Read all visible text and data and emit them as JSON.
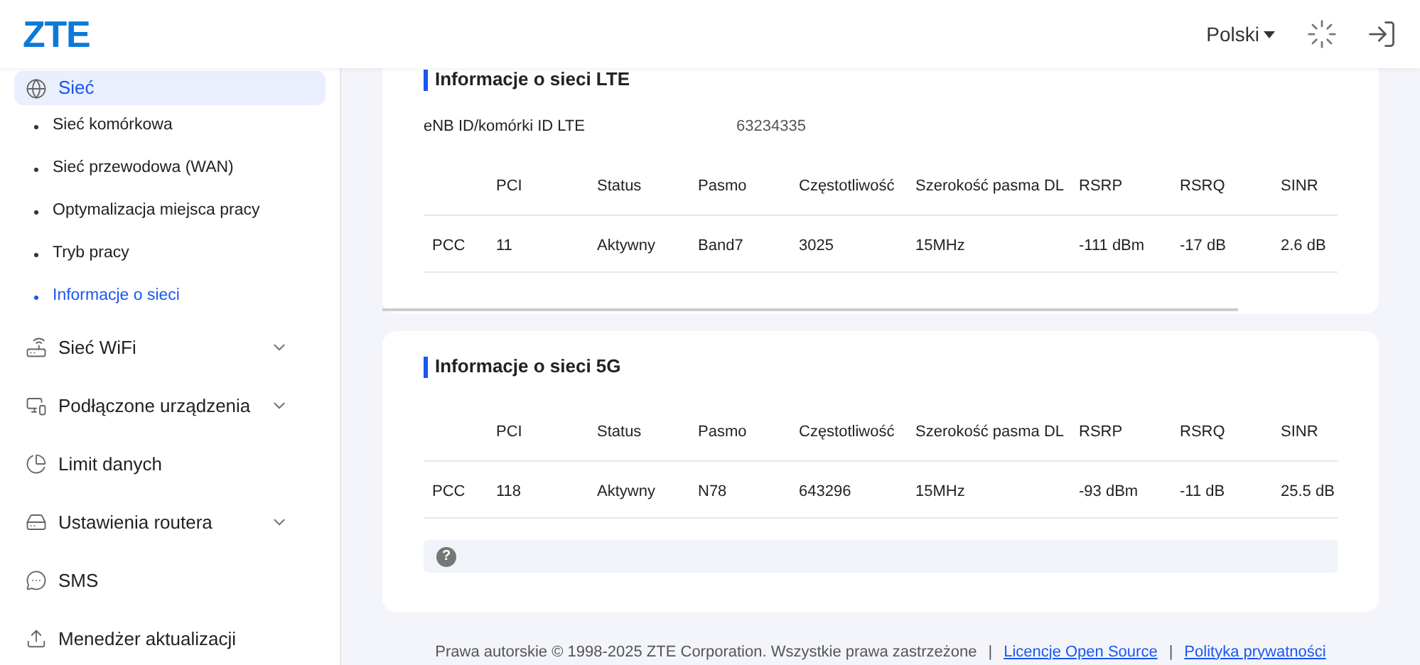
{
  "header": {
    "logo": "ZTE",
    "language": "Polski"
  },
  "sidebar": {
    "items": [
      {
        "label": "Sieć",
        "expanded": true,
        "selected": true,
        "children": [
          {
            "label": "Sieć komórkowa",
            "selected": false
          },
          {
            "label": "Sieć przewodowa (WAN)",
            "selected": false
          },
          {
            "label": "Optymalizacja miejsca pracy",
            "selected": false
          },
          {
            "label": "Tryb pracy",
            "selected": false
          },
          {
            "label": "Informacje o sieci",
            "selected": true
          }
        ]
      },
      {
        "label": "Sieć WiFi",
        "expanded": false,
        "selected": false
      },
      {
        "label": "Podłączone urządzenia",
        "expanded": false,
        "selected": false
      },
      {
        "label": "Limit danych",
        "selected": false
      },
      {
        "label": "Ustawienia routera",
        "expanded": false,
        "selected": false
      },
      {
        "label": "SMS",
        "selected": false
      },
      {
        "label": "Menedżer aktualizacji",
        "selected": false
      }
    ]
  },
  "lte": {
    "title": "Informacje o sieci LTE",
    "fields": [
      {
        "label": "eNB ID/komórki ID LTE",
        "value": "63234335"
      }
    ],
    "table": {
      "columns": [
        "",
        "PCI",
        "Status",
        "Pasmo",
        "Częstotliwość",
        "Szerokość pasma DL",
        "RSRP",
        "RSRQ",
        "SINR"
      ],
      "rows": [
        [
          "PCC",
          "11",
          "Aktywny",
          "Band7",
          "3025",
          "15MHz",
          "-111 dBm",
          "-17 dB",
          "2.6 dB"
        ]
      ]
    }
  },
  "nr": {
    "title": "Informacje o sieci 5G",
    "table": {
      "columns": [
        "",
        "PCI",
        "Status",
        "Pasmo",
        "Częstotliwość",
        "Szerokość pasma DL",
        "RSRP",
        "RSRQ",
        "SINR"
      ],
      "rows": [
        [
          "PCC",
          "118",
          "Aktywny",
          "N78",
          "643296",
          "15MHz",
          "-93 dBm",
          "-11 dB",
          "25.5 dB"
        ]
      ]
    },
    "help": "?"
  },
  "footer": {
    "copyright": "Prawa autorskie © 1998-2025 ZTE Corporation. Wszystkie prawa zastrzeżone",
    "separator": "|",
    "links": [
      "Licencje Open Source",
      "Polityka prywatności"
    ]
  }
}
